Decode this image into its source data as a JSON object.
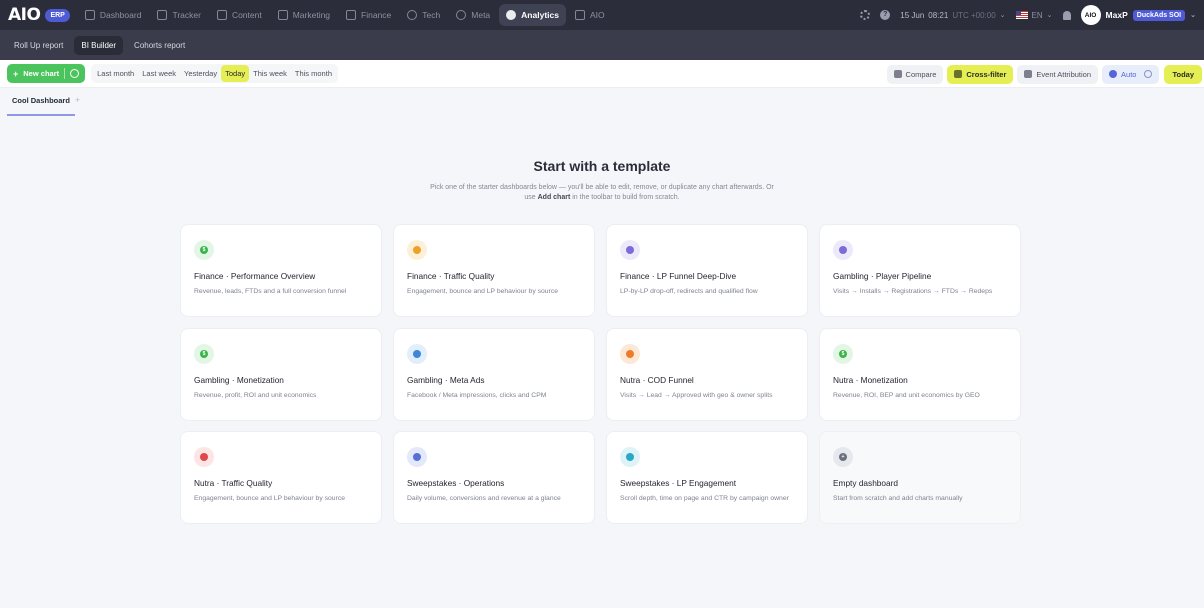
{
  "brand": {
    "logo": "AIO",
    "badge": "ERP"
  },
  "nav": {
    "items": [
      {
        "label": "Dashboard",
        "icon": "dashboard-icon"
      },
      {
        "label": "Tracker",
        "icon": "tracker-icon"
      },
      {
        "label": "Content",
        "icon": "content-icon"
      },
      {
        "label": "Marketing",
        "icon": "marketing-icon"
      },
      {
        "label": "Finance",
        "icon": "finance-icon"
      },
      {
        "label": "Tech",
        "icon": "tech-icon"
      },
      {
        "label": "Meta",
        "icon": "meta-icon"
      },
      {
        "label": "Analytics",
        "icon": "analytics-icon"
      },
      {
        "label": "AIO",
        "icon": "aio-icon"
      }
    ],
    "active": "Analytics",
    "date": "15 Jun",
    "time": "08:21",
    "timezone": "UTC +00:00",
    "language": "EN",
    "user_name": "MaxP",
    "avatar_text": "AIO",
    "workspace": "DuckAds SOI"
  },
  "subnav": {
    "tabs": [
      "Roll Up report",
      "BI Builder",
      "Cohorts report"
    ],
    "active": "BI Builder"
  },
  "toolbar": {
    "new_chart": "New chart",
    "ranges": [
      "Last month",
      "Last week",
      "Yesterday",
      "Today",
      "This week",
      "This month"
    ],
    "active_range": "Today",
    "compare": "Compare",
    "cross_filter": "Cross-filter",
    "event_attribution": "Event Attribution",
    "auto": "Auto",
    "today": "Today"
  },
  "dashboard_tabs": {
    "current": "Cool Dashboard",
    "add": "+"
  },
  "main": {
    "title": "Start with a template",
    "subtitle_prefix": "Pick one of the starter dashboards below — you'll be able to edit, remove, or duplicate any chart afterwards. Or use ",
    "subtitle_bold": "Add chart",
    "subtitle_suffix": " in the toolbar to build from scratch."
  },
  "templates": [
    {
      "title": "Finance · Performance Overview",
      "desc": "Revenue, leads, FTDs and a full conversion funnel",
      "icon": "dollar-icon",
      "color": "#3ab54a"
    },
    {
      "title": "Finance · Traffic Quality",
      "desc": "Engagement, bounce and LP behaviour by source",
      "icon": "shield-icon",
      "color": "#f0a028"
    },
    {
      "title": "Finance · LP Funnel Deep-Dive",
      "desc": "LP-by-LP drop-off, redirects and qualified flow",
      "icon": "funnel-icon",
      "color": "#7d6bd8"
    },
    {
      "title": "Gambling · Player Pipeline",
      "desc": "Visits → Installs → Registrations → FTDs → Redeps",
      "icon": "pipeline-icon",
      "color": "#7d6bd8"
    },
    {
      "title": "Gambling · Monetization",
      "desc": "Revenue, profit, ROI and unit economics",
      "icon": "dollar-icon",
      "color": "#3ab54a"
    },
    {
      "title": "Gambling · Meta Ads",
      "desc": "Facebook / Meta impressions, clicks and CPM",
      "icon": "target-icon",
      "color": "#3d86d8"
    },
    {
      "title": "Nutra · COD Funnel",
      "desc": "Visits → Lead → Approved with geo & owner splits",
      "icon": "package-icon",
      "color": "#ee7a2b"
    },
    {
      "title": "Nutra · Monetization",
      "desc": "Revenue, ROI, BEP and unit economics by GEO",
      "icon": "dollar-icon",
      "color": "#3ab54a"
    },
    {
      "title": "Nutra · Traffic Quality",
      "desc": "Engagement, bounce and LP behaviour by source",
      "icon": "shield-icon",
      "color": "#e0464e"
    },
    {
      "title": "Sweepstakes · Operations",
      "desc": "Daily volume, conversions and revenue at a glance",
      "icon": "operations-icon",
      "color": "#5570d6"
    },
    {
      "title": "Sweepstakes · LP Engagement",
      "desc": "Scroll depth, time on page and CTR by campaign owner",
      "icon": "engagement-icon",
      "color": "#2aa7c4"
    },
    {
      "title": "Empty dashboard",
      "desc": "Start from scratch and add charts manually",
      "icon": "plus-icon",
      "color": "#6b7080"
    }
  ]
}
